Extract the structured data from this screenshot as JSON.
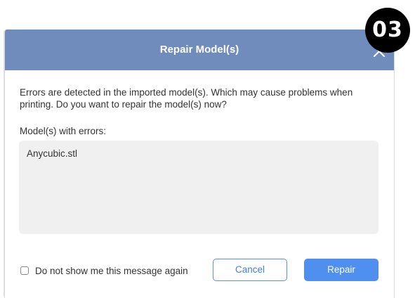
{
  "dialog": {
    "title": "Repair Model(s)",
    "message": "Errors are detected in the imported model(s). Which may cause problems when printing. Do you want to repair the model(s) now?",
    "errors_label": "Model(s) with errors:",
    "models": [
      "Anycubic.stl"
    ],
    "checkbox_label": "Do not show me this message again",
    "checkbox_checked": false,
    "cancel_label": "Cancel",
    "repair_label": "Repair",
    "close_icon": "close-icon"
  },
  "badge": {
    "text": "03"
  },
  "colors": {
    "titlebar": "#6f8cbc",
    "primary_button": "#4f8ff0",
    "cancel_border": "#5a91e8",
    "list_background": "#f0f0f0",
    "badge_background": "#000000"
  }
}
